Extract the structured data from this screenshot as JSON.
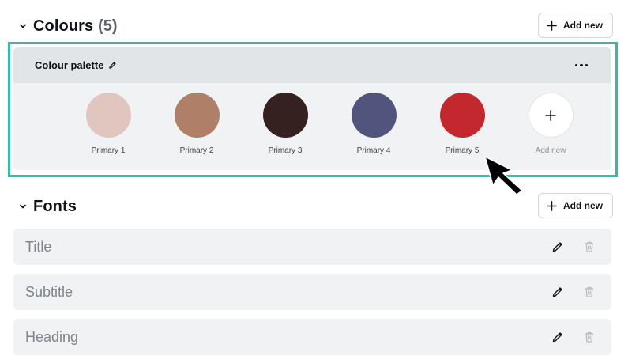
{
  "colours_section": {
    "title": "Colours",
    "count": "(5)",
    "add_label": "Add new"
  },
  "palette": {
    "name": "Colour palette",
    "swatches": [
      {
        "label": "Primary 1",
        "color": "#e0c6bf"
      },
      {
        "label": "Primary 2",
        "color": "#b07f68"
      },
      {
        "label": "Primary 3",
        "color": "#35211f"
      },
      {
        "label": "Primary 4",
        "color": "#51547c"
      },
      {
        "label": "Primary 5",
        "color": "#c2282e"
      }
    ],
    "add_label": "Add new"
  },
  "fonts_section": {
    "title": "Fonts",
    "add_label": "Add new",
    "items": [
      {
        "label": "Title"
      },
      {
        "label": "Subtitle"
      },
      {
        "label": "Heading"
      }
    ]
  },
  "colors": {
    "highlight": "#2ebfa5",
    "card_bg": "#f1f2f4",
    "card_header_bg": "#e2e5e8"
  },
  "icons": [
    "chevron-down-icon",
    "plus-icon",
    "pencil-icon",
    "more-horizontal-icon",
    "trash-icon",
    "mouse-cursor-icon"
  ]
}
